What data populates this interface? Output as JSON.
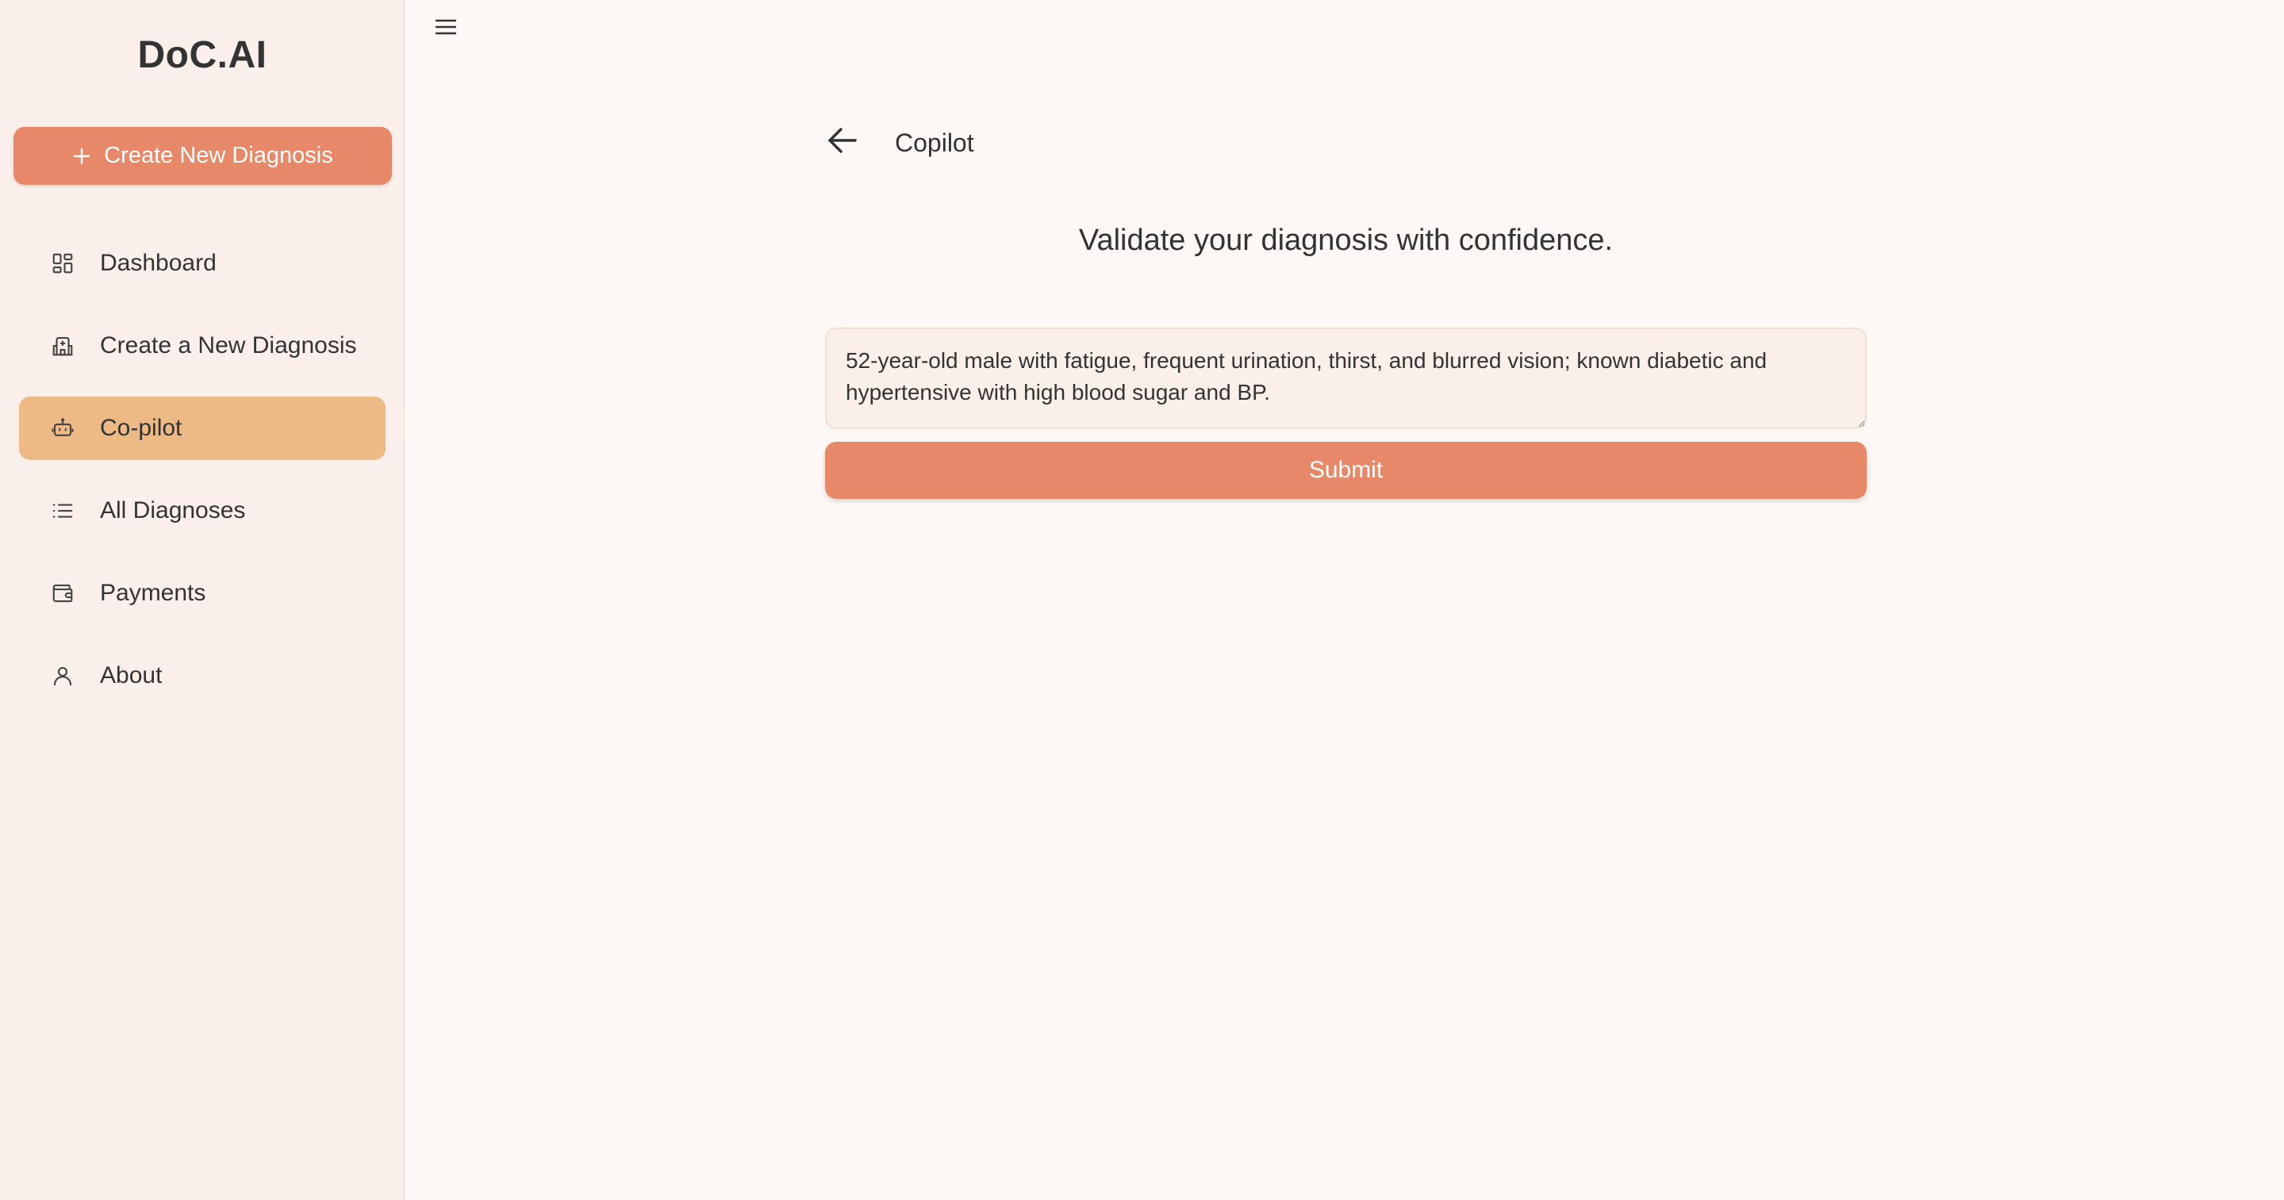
{
  "app": {
    "brand": "DoC.AI"
  },
  "sidebar": {
    "create_button": {
      "label": "Create New Diagnosis",
      "icon": "plus-icon"
    },
    "items": [
      {
        "label": "Dashboard",
        "icon": "dashboard-icon",
        "active": false
      },
      {
        "label": "Create a New Diagnosis",
        "icon": "hospital-icon",
        "active": false
      },
      {
        "label": "Co-pilot",
        "icon": "robot-icon",
        "active": true
      },
      {
        "label": "All Diagnoses",
        "icon": "list-icon",
        "active": false
      },
      {
        "label": "Payments",
        "icon": "wallet-icon",
        "active": false
      },
      {
        "label": "About",
        "icon": "user-icon",
        "active": false
      }
    ]
  },
  "header": {
    "menu_icon": "hamburger-menu-icon"
  },
  "main": {
    "back_icon": "arrow-left-icon",
    "title": "Copilot",
    "tagline": "Validate your diagnosis with confidence.",
    "input": {
      "value": "52-year-old male with fatigue, frequent urination, thirst, and blurred vision; known diabetic and hypertensive with high blood sugar and BP."
    },
    "submit_label": "Submit"
  },
  "colors": {
    "accent": "#e78968",
    "active_nav": "#edb985",
    "sidebar_bg": "#faefea",
    "main_bg": "#fdf8f5",
    "text": "#333333"
  }
}
